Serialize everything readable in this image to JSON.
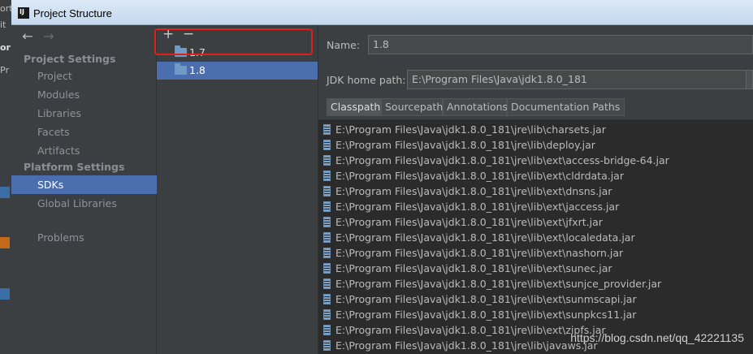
{
  "background": {
    "fragments": [
      "ort",
      "it",
      "or",
      "Pr"
    ]
  },
  "window": {
    "title": "Project Structure"
  },
  "sidebar": {
    "nav": {
      "back": "←",
      "forward": "→"
    },
    "project_settings": {
      "heading": "Project Settings",
      "items": [
        "Project",
        "Modules",
        "Libraries",
        "Facets",
        "Artifacts"
      ]
    },
    "platform_settings": {
      "heading": "Platform Settings",
      "items": [
        "SDKs",
        "Global Libraries"
      ],
      "selected": "SDKs"
    },
    "problems": "Problems"
  },
  "sdk_list": {
    "add": "+",
    "remove": "−",
    "items": [
      "1.7",
      "1.8"
    ],
    "selected": "1.8"
  },
  "sdk_detail": {
    "name_label": "Name:",
    "name_value": "1.8",
    "home_label": "JDK home path:",
    "home_value": "E:\\Program Files\\Java\\jdk1.8.0_181",
    "tabs": [
      "Classpath",
      "Sourcepath",
      "Annotations",
      "Documentation Paths"
    ],
    "active_tab": "Classpath",
    "classpath": [
      "E:\\Program Files\\Java\\jdk1.8.0_181\\jre\\lib\\charsets.jar",
      "E:\\Program Files\\Java\\jdk1.8.0_181\\jre\\lib\\deploy.jar",
      "E:\\Program Files\\Java\\jdk1.8.0_181\\jre\\lib\\ext\\access-bridge-64.jar",
      "E:\\Program Files\\Java\\jdk1.8.0_181\\jre\\lib\\ext\\cldrdata.jar",
      "E:\\Program Files\\Java\\jdk1.8.0_181\\jre\\lib\\ext\\dnsns.jar",
      "E:\\Program Files\\Java\\jdk1.8.0_181\\jre\\lib\\ext\\jaccess.jar",
      "E:\\Program Files\\Java\\jdk1.8.0_181\\jre\\lib\\ext\\jfxrt.jar",
      "E:\\Program Files\\Java\\jdk1.8.0_181\\jre\\lib\\ext\\localedata.jar",
      "E:\\Program Files\\Java\\jdk1.8.0_181\\jre\\lib\\ext\\nashorn.jar",
      "E:\\Program Files\\Java\\jdk1.8.0_181\\jre\\lib\\ext\\sunec.jar",
      "E:\\Program Files\\Java\\jdk1.8.0_181\\jre\\lib\\ext\\sunjce_provider.jar",
      "E:\\Program Files\\Java\\jdk1.8.0_181\\jre\\lib\\ext\\sunmscapi.jar",
      "E:\\Program Files\\Java\\jdk1.8.0_181\\jre\\lib\\ext\\sunpkcs11.jar",
      "E:\\Program Files\\Java\\jdk1.8.0_181\\jre\\lib\\ext\\zipfs.jar",
      "E:\\Program Files\\Java\\jdk1.8.0_181\\jre\\lib\\javaws.jar"
    ]
  },
  "watermark": "https://blog.csdn.net/qq_42221135",
  "colors": {
    "selection": "#4b6eaf",
    "highlight_box": "#e0201a",
    "panel": "#3c3f41",
    "list_bg": "#2b2b2b"
  }
}
